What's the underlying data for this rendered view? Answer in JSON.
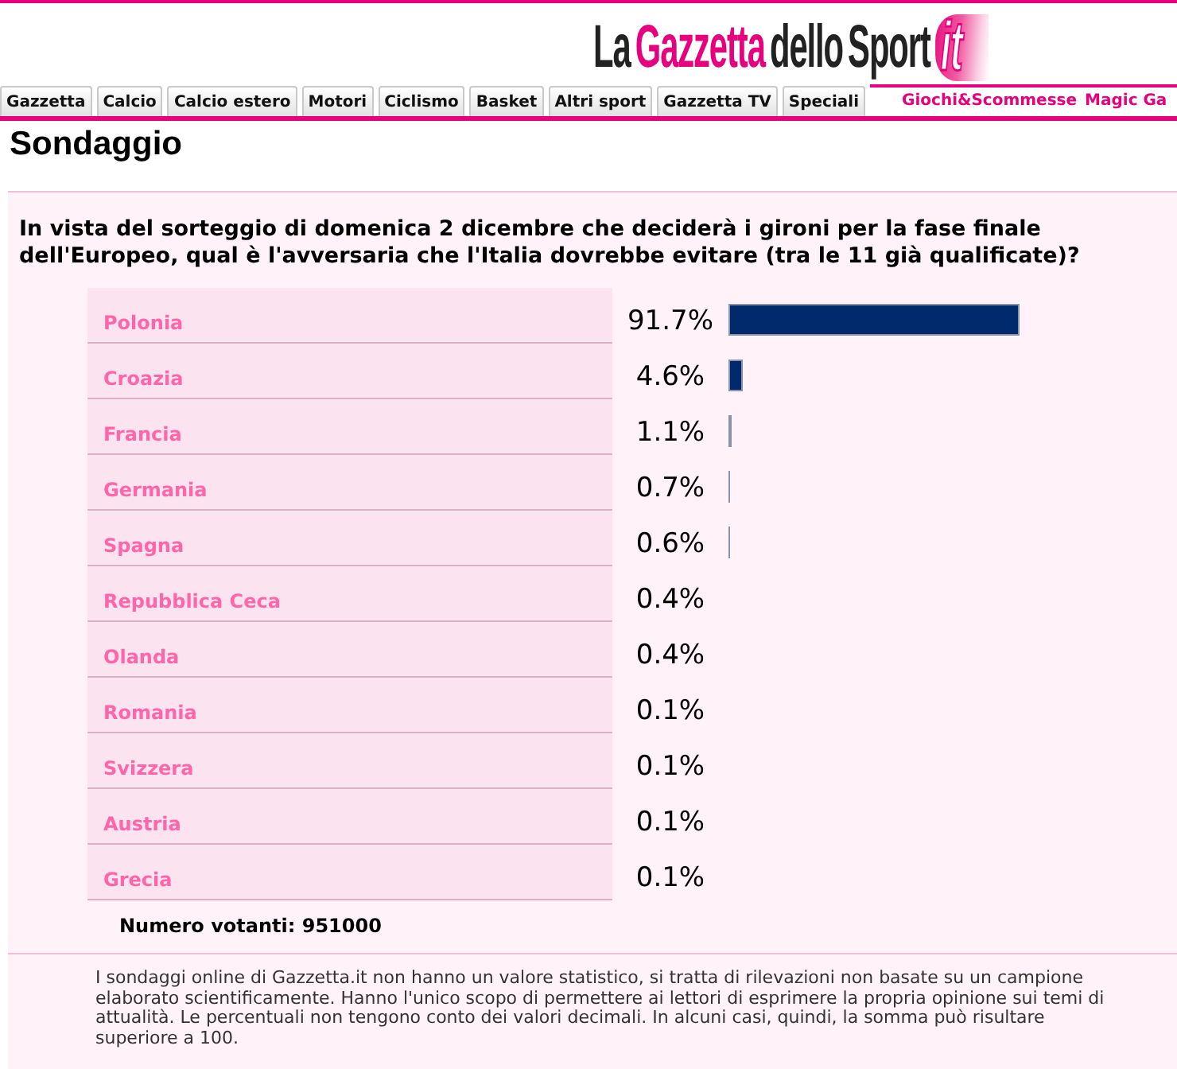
{
  "header": {
    "logo": {
      "segments": [
        {
          "text": "La",
          "accent": false
        },
        {
          "text": "Gazzetta",
          "accent": true
        },
        {
          "text": "dello Sport",
          "accent": false
        }
      ],
      "domain": "it"
    }
  },
  "nav": {
    "tabs": [
      {
        "label": "Gazzetta"
      },
      {
        "label": "Calcio"
      },
      {
        "label": "Calcio estero"
      },
      {
        "label": "Motori"
      },
      {
        "label": "Ciclismo"
      },
      {
        "label": "Basket"
      },
      {
        "label": "Altri sport"
      },
      {
        "label": "Gazzetta TV"
      },
      {
        "label": "Speciali"
      }
    ],
    "links": [
      "Giochi&Scommesse",
      "Magic Ga"
    ]
  },
  "page_title": "Sondaggio",
  "poll": {
    "question": "In vista del sorteggio di domenica 2 dicembre che deciderà i gironi per la fase finale dell'Europeo, qual è l'avversaria che l'Italia dovrebbe evitare (tra le 11 già qualificate)?",
    "results": {
      "chart_data": {
        "type": "bar",
        "orientation": "horizontal",
        "categories": [
          "Polonia",
          "Croazia",
          "Francia",
          "Germania",
          "Spagna",
          "Repubblica Ceca",
          "Olanda",
          "Romania",
          "Svizzera",
          "Austria",
          "Grecia"
        ],
        "values": [
          91.7,
          4.6,
          1.1,
          0.7,
          0.6,
          0.4,
          0.4,
          0.1,
          0.1,
          0.1,
          0.1
        ],
        "value_labels": [
          "91.7%",
          "4.6%",
          "1.1%",
          "0.7%",
          "0.6%",
          "0.4%",
          "0.4%",
          "0.1%",
          "0.1%",
          "0.1%",
          "0.1%"
        ]
      }
    },
    "voters": "Numero votanti: 951000",
    "disclaimer": "I sondaggi online di Gazzetta.it non hanno un valore statistico, si tratta di rilevazioni non basate su un campione elaborato scientificamente. Hanno l'unico scopo di permettere ai lettori di esprimere la propria opinione sui temi di attualità. Le percentuali non tengono conto dei valori decimali. In alcuni casi, quindi, la somma può risultare superiore a 100."
  }
}
